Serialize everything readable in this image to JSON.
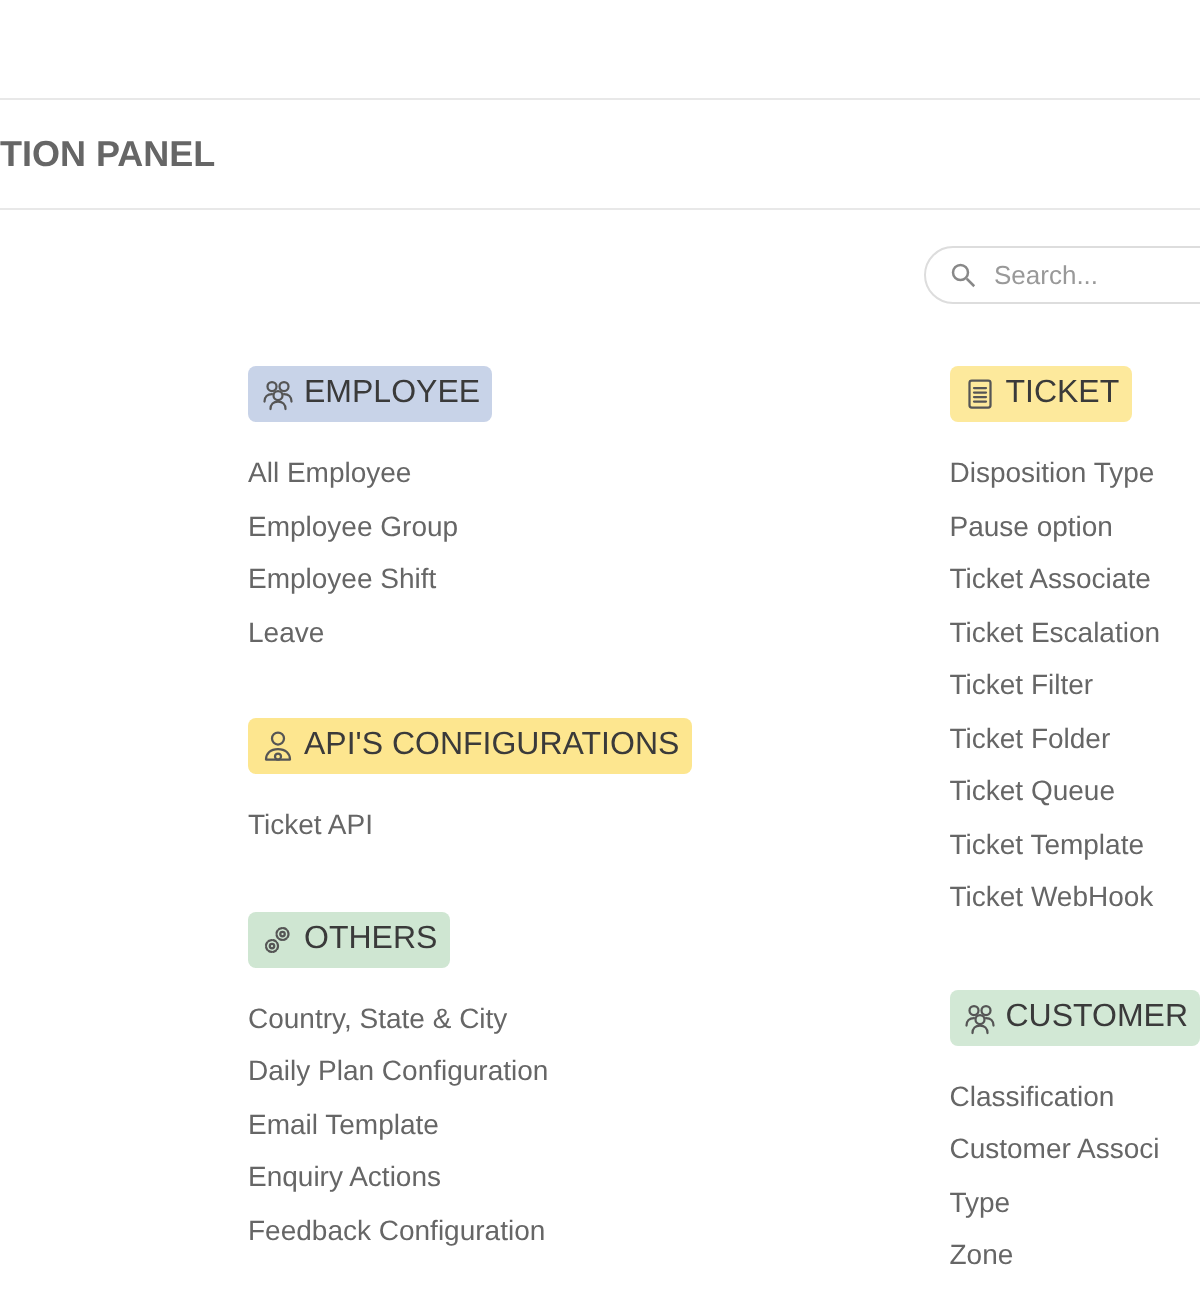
{
  "header": {
    "title": "TION PANEL"
  },
  "search": {
    "placeholder": "Search..."
  },
  "columns": [
    {
      "sections": [
        {
          "title": "EMPLOYEE",
          "kind": "people",
          "color": "#c8d3e8",
          "items": [
            "All Employee",
            "Employee Group",
            "Employee Shift",
            "Leave"
          ]
        },
        {
          "title": "API'S CONFIGURATIONS",
          "kind": "api",
          "color": "#fde68f",
          "items": [
            "Ticket API"
          ]
        },
        {
          "title": "OTHERS",
          "kind": "gear",
          "color": "#cfe6d2",
          "items": [
            "Country, State & City",
            "Daily Plan Configuration",
            "Email Template",
            "Enquiry Actions",
            "Feedback Configuration"
          ]
        }
      ]
    },
    {
      "sections": [
        {
          "title": "TICKET",
          "kind": "document",
          "color": "#fde99c",
          "items": [
            "Disposition Type",
            "Pause option",
            "Ticket Associate",
            "Ticket Escalation",
            "Ticket Filter",
            "Ticket Folder",
            "Ticket Queue",
            "Ticket Template",
            "Ticket WebHook"
          ]
        },
        {
          "title": "CUSTOMER",
          "kind": "people",
          "color": "#d2e8d5",
          "items": [
            "Classification",
            "Customer Associ",
            "Type",
            "Zone"
          ]
        }
      ]
    }
  ]
}
